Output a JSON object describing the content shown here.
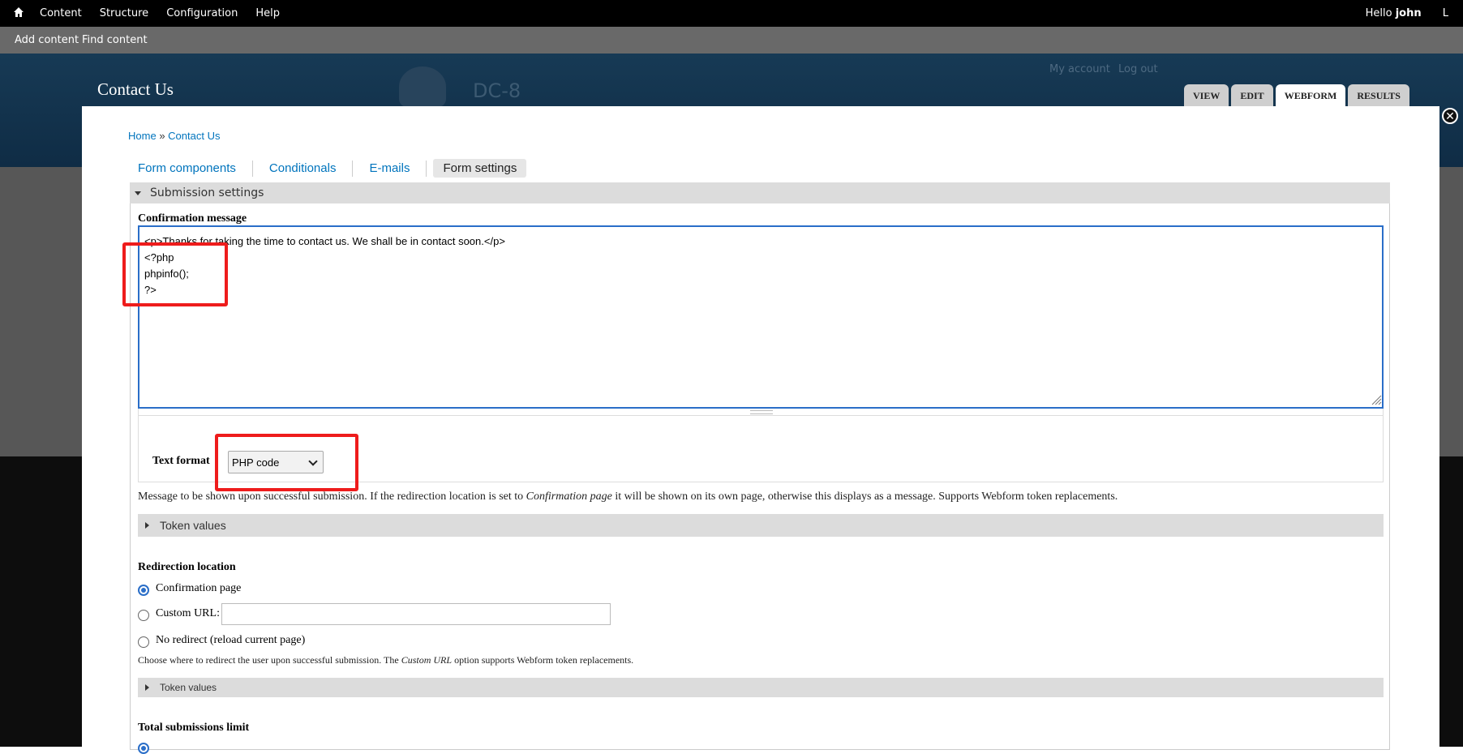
{
  "toolbar": {
    "menu": [
      "Content",
      "Structure",
      "Configuration",
      "Help"
    ],
    "greeting": "Hello",
    "username": "john",
    "extra": "L"
  },
  "shortcuts": [
    "Add content",
    "Find content"
  ],
  "site": {
    "page_title": "Contact Us",
    "site_name": "DC-8",
    "account_links": [
      "My account",
      "Log out"
    ]
  },
  "tabs": [
    "VIEW",
    "EDIT",
    "WEBFORM",
    "RESULTS"
  ],
  "active_tab": "WEBFORM",
  "close_symbol": "✕",
  "breadcrumb": {
    "home": "Home",
    "separator": "»",
    "current": "Contact Us"
  },
  "subtabs": [
    "Form components",
    "Conditionals",
    "E-mails",
    "Form settings"
  ],
  "active_subtab": "Form settings",
  "submission_settings": {
    "legend": "Submission settings",
    "confirmation_label": "Confirmation message",
    "confirmation_value": "<p>Thanks for taking the time to contact us. We shall be in contact soon.</p>\n<?php\nphpinfo();\n?>",
    "text_format_label": "Text format",
    "text_format_value": "PHP code",
    "message_desc_1": "Message to be shown upon successful submission. If the redirection location is set to ",
    "message_desc_em": "Confirmation page",
    "message_desc_2": " it will be shown on its own page, otherwise this displays as a message. Supports Webform token replacements.",
    "token_values_label": "Token values",
    "redirection_label": "Redirection location",
    "redirect_options": [
      "Confirmation page",
      "Custom URL:",
      "No redirect (reload current page)"
    ],
    "redirect_selected": "Confirmation page",
    "custom_url_value": "",
    "redirect_desc_1": "Choose where to redirect the user upon successful submission. The ",
    "redirect_desc_em": "Custom URL",
    "redirect_desc_2": " option supports Webform token replacements.",
    "token_values_label_2": "Token values",
    "total_limit_label": "Total submissions limit"
  },
  "colors": {
    "link": "#0074bd",
    "highlight": "#ee1c1c",
    "focus": "#2a6ec8"
  }
}
